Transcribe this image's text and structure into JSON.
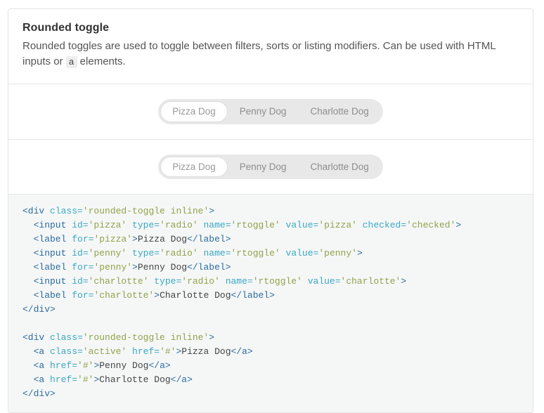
{
  "card": {
    "title": "Rounded toggle",
    "description_part1": "Rounded toggles are used to toggle between filters, sorts or listing modifiers. Can be used with HTML inputs or ",
    "description_code": "a",
    "description_part2": " elements."
  },
  "toggles": [
    {
      "name": "radio-toggle",
      "options": [
        {
          "label": "Pizza Dog",
          "active": true
        },
        {
          "label": "Penny Dog",
          "active": false
        },
        {
          "label": "Charlotte Dog",
          "active": false
        }
      ]
    },
    {
      "name": "anchor-toggle",
      "options": [
        {
          "label": "Pizza Dog",
          "active": true
        },
        {
          "label": "Penny Dog",
          "active": false
        },
        {
          "label": "Charlotte Dog",
          "active": false
        }
      ]
    }
  ],
  "code": {
    "lines": [
      [
        {
          "t": "tag",
          "s": "<div "
        },
        {
          "t": "attr",
          "s": "class="
        },
        {
          "t": "val",
          "s": "'rounded-toggle inline'"
        },
        {
          "t": "tag",
          "s": ">"
        }
      ],
      [
        {
          "t": "tag",
          "s": "  <input "
        },
        {
          "t": "attr",
          "s": "id="
        },
        {
          "t": "val",
          "s": "'pizza' "
        },
        {
          "t": "attr",
          "s": "type="
        },
        {
          "t": "val",
          "s": "'radio' "
        },
        {
          "t": "attr",
          "s": "name="
        },
        {
          "t": "val",
          "s": "'rtoggle' "
        },
        {
          "t": "attr",
          "s": "value="
        },
        {
          "t": "val",
          "s": "'pizza' "
        },
        {
          "t": "attr",
          "s": "checked="
        },
        {
          "t": "val",
          "s": "'checked'"
        },
        {
          "t": "tag",
          "s": ">"
        }
      ],
      [
        {
          "t": "tag",
          "s": "  <label "
        },
        {
          "t": "attr",
          "s": "for="
        },
        {
          "t": "val",
          "s": "'pizza'"
        },
        {
          "t": "tag",
          "s": ">"
        },
        {
          "t": "text",
          "s": "Pizza Dog"
        },
        {
          "t": "tag",
          "s": "</label>"
        }
      ],
      [
        {
          "t": "tag",
          "s": "  <input "
        },
        {
          "t": "attr",
          "s": "id="
        },
        {
          "t": "val",
          "s": "'penny' "
        },
        {
          "t": "attr",
          "s": "type="
        },
        {
          "t": "val",
          "s": "'radio' "
        },
        {
          "t": "attr",
          "s": "name="
        },
        {
          "t": "val",
          "s": "'rtoggle' "
        },
        {
          "t": "attr",
          "s": "value="
        },
        {
          "t": "val",
          "s": "'penny'"
        },
        {
          "t": "tag",
          "s": ">"
        }
      ],
      [
        {
          "t": "tag",
          "s": "  <label "
        },
        {
          "t": "attr",
          "s": "for="
        },
        {
          "t": "val",
          "s": "'penny'"
        },
        {
          "t": "tag",
          "s": ">"
        },
        {
          "t": "text",
          "s": "Penny Dog"
        },
        {
          "t": "tag",
          "s": "</label>"
        }
      ],
      [
        {
          "t": "tag",
          "s": "  <input "
        },
        {
          "t": "attr",
          "s": "id="
        },
        {
          "t": "val",
          "s": "'charlotte' "
        },
        {
          "t": "attr",
          "s": "type="
        },
        {
          "t": "val",
          "s": "'radio' "
        },
        {
          "t": "attr",
          "s": "name="
        },
        {
          "t": "val",
          "s": "'rtoggle' "
        },
        {
          "t": "attr",
          "s": "value="
        },
        {
          "t": "val",
          "s": "'charlotte'"
        },
        {
          "t": "tag",
          "s": ">"
        }
      ],
      [
        {
          "t": "tag",
          "s": "  <label "
        },
        {
          "t": "attr",
          "s": "for="
        },
        {
          "t": "val",
          "s": "'charlotte'"
        },
        {
          "t": "tag",
          "s": ">"
        },
        {
          "t": "text",
          "s": "Charlotte Dog"
        },
        {
          "t": "tag",
          "s": "</label>"
        }
      ],
      [
        {
          "t": "tag",
          "s": "</div>"
        }
      ],
      [],
      [
        {
          "t": "tag",
          "s": "<div "
        },
        {
          "t": "attr",
          "s": "class="
        },
        {
          "t": "val",
          "s": "'rounded-toggle inline'"
        },
        {
          "t": "tag",
          "s": ">"
        }
      ],
      [
        {
          "t": "tag",
          "s": "  <a "
        },
        {
          "t": "attr",
          "s": "class="
        },
        {
          "t": "val",
          "s": "'active' "
        },
        {
          "t": "attr",
          "s": "href="
        },
        {
          "t": "val",
          "s": "'#'"
        },
        {
          "t": "tag",
          "s": ">"
        },
        {
          "t": "text",
          "s": "Pizza Dog"
        },
        {
          "t": "tag",
          "s": "</a>"
        }
      ],
      [
        {
          "t": "tag",
          "s": "  <a "
        },
        {
          "t": "attr",
          "s": "href="
        },
        {
          "t": "val",
          "s": "'#'"
        },
        {
          "t": "tag",
          "s": ">"
        },
        {
          "t": "text",
          "s": "Penny Dog"
        },
        {
          "t": "tag",
          "s": "</a>"
        }
      ],
      [
        {
          "t": "tag",
          "s": "  <a "
        },
        {
          "t": "attr",
          "s": "href="
        },
        {
          "t": "val",
          "s": "'#'"
        },
        {
          "t": "tag",
          "s": ">"
        },
        {
          "t": "text",
          "s": "Charlotte Dog"
        },
        {
          "t": "tag",
          "s": "</a>"
        }
      ],
      [
        {
          "t": "tag",
          "s": "</div>"
        }
      ]
    ]
  },
  "colors": {
    "tag": "#2b6b9e",
    "attribute": "#3ba7c4",
    "string": "#8fa34a",
    "text": "#444444",
    "code_background": "#f5f7f7",
    "toggle_track": "#e8e8e8",
    "toggle_active_background": "#ffffff",
    "card_border": "#e3e3e3"
  }
}
